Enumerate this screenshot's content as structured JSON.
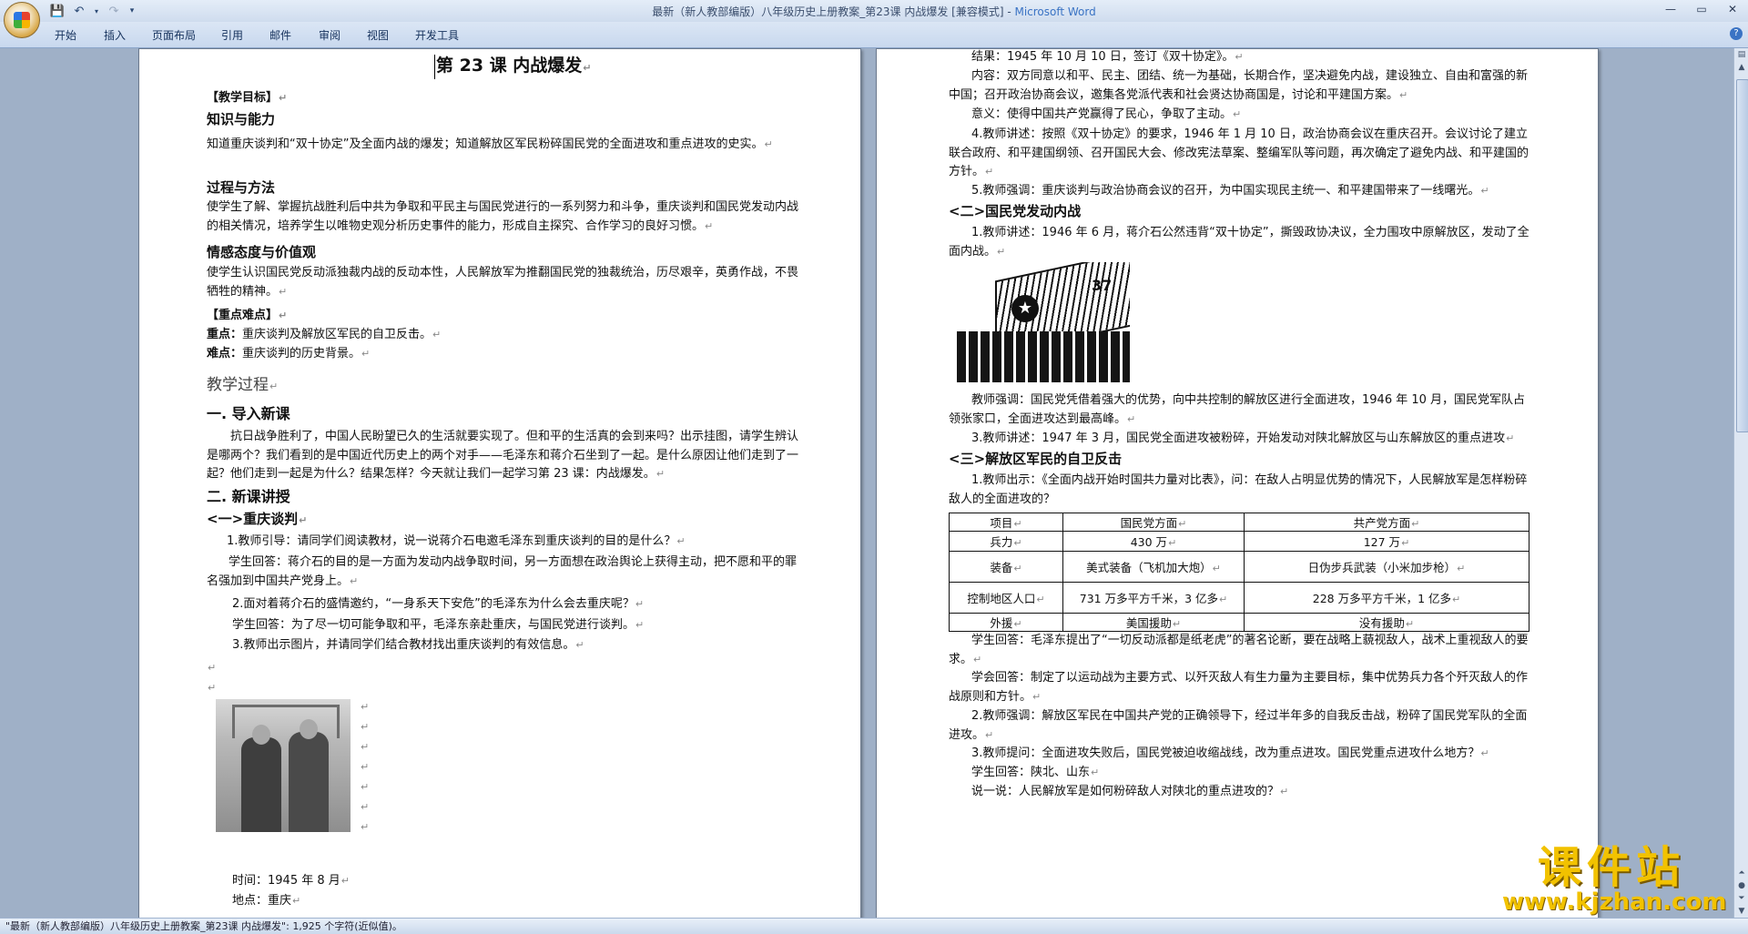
{
  "window": {
    "title_doc": "最新（新人教部编版）八年级历史上册教案_第23课  内战爆发 [兼容模式] - ",
    "title_app": "Microsoft Word"
  },
  "ribbon": {
    "tabs": [
      "开始",
      "插入",
      "页面布局",
      "引用",
      "邮件",
      "审阅",
      "视图",
      "开发工具"
    ]
  },
  "page1": {
    "title": "第 23 课    内战爆发",
    "p1": "【教学目标】",
    "p2": "知识与能力",
    "p3": "知道重庆谈判和“双十协定”及全面内战的爆发；知道解放区军民粉碎国民党的全面进攻和重点进攻的史实。",
    "p4": "过程与方法",
    "p5": "使学生了解、掌握抗战胜利后中共为争取和平民主与国民党进行的一系列努力和斗争，重庆谈判和国民党发动内战的相关情况，培养学生以唯物史观分析历史事件的能力，形成自主探究、合作学习的良好习惯。",
    "p6": "情感态度与价值观",
    "p7": "使学生认识国民党反动派独裁内战的反动本性，人民解放军为推翻国民党的独裁统治，历尽艰辛，英勇作战，不畏牺牲的精神。",
    "p8": "【重点难点】",
    "p9a": "重点：",
    "p9b": "重庆谈判及解放区军民的自卫反击。",
    "p10a": "难点：",
    "p10b": "重庆谈判的历史背景。",
    "p11": "教学过程",
    "p12": "一. 导入新课",
    "p13": "抗日战争胜利了，中国人民盼望已久的生活就要实现了。但和平的生活真的会到来吗？出示挂图，请学生辨认是哪两个？我们看到的是中国近代历史上的两个对手——毛泽东和蒋介石坐到了一起。是什么原因让他们走到了一起？他们走到一起是为什么？结果怎样？今天就让我们一起学习第 23 课：内战爆发。",
    "p14": "二. 新课讲授",
    "p15": "<一>重庆谈判",
    "p16": "1.教师引导：请同学们阅读教材，说一说蒋介石电邀毛泽东到重庆谈判的目的是什么？",
    "p17": "学生回答：蒋介石的目的是一方面为发动内战争取时间，另一方面想在政治舆论上获得主动，把不愿和平的罪名强加到中国共产党身上。",
    "p18": "2.面对着蒋介石的盛情邀约，“一身系天下安危”的毛泽东为什么会去重庆呢？",
    "p19": "学生回答：为了尽一切可能争取和平，毛泽东亲赴重庆，与国民党进行谈判。",
    "p20": "3.教师出示图片，并请同学们结合教材找出重庆谈判的有效信息。",
    "p21": "时间：1945 年 8 月",
    "p22": "地点：重庆"
  },
  "page2": {
    "q1": "结果：1945 年 10 月 10 日，签订《双十协定》。",
    "q2": "内容：双方同意以和平、民主、团结、统一为基础，长期合作，坚决避免内战，建设独立、自由和富强的新中国；召开政治协商会议，邀集各党派代表和社会贤达协商国是，讨论和平建国方案。",
    "q3": "意义：使得中国共产党赢得了民心，争取了主动。",
    "q4": "4.教师讲述：按照《双十协定》的要求，1946 年 1 月 10 日，政治协商会议在重庆召开。会议讨论了建立联合政府、和平建国纲领、召开国民大会、修改宪法草案、整编军队等问题，再次确定了避免内战、和平建国的方针。",
    "q5": "5.教师强调：重庆谈判与政治协商会议的召开，为中国实现民主统一、和平建国带来了一线曙光。",
    "q6": "<二>国民党发动内战",
    "q7": "1.教师讲述：1946 年 6 月，蒋介石公然违背“双十协定”，撕毁政协决议，全力围攻中原解放区，发动了全面内战。",
    "q8": "教师强调：国民党凭借着强大的优势，向中共控制的解放区进行全面进攻，1946 年 10 月，国民党军队占领张家口，全面进攻达到最高峰。",
    "q9": "3.教师讲述：1947 年 3 月，国民党全面进攻被粉碎，开始发动对陕北解放区与山东解放区的重点进攻",
    "q10": "<三>解放区军民的自卫反击",
    "q11": "1.教师出示：《全面内战开始时国共力量对比表》，问：在敌人占明显优势的情况下，人民解放军是怎样粉碎敌人的全面进攻的？",
    "q12": "学生回答：毛泽东提出了“一切反动派都是纸老虎”的著名论断，要在战略上藐视敌人，战术上重视敌人的要求。",
    "q13": "学会回答：制定了以运动战为主要方式、以歼灭敌人有生力量为主要目标，集中优势兵力各个歼灭敌人的作战原则和方针。",
    "q14": "2.教师强调：解放区军民在中国共产党的正确领导下，经过半年多的自我反击战，粉碎了国民党军队的全面进攻。",
    "q15": "3.教师提问：全面进攻失败后，国民党被迫收缩战线，改为重点进攻。国民党重点进攻什么地方？",
    "q16": "学生回答：陕北、山东",
    "q17": "说一说：人民解放军是如何粉碎敌人对陕北的重点进攻的？",
    "plane_number": "37",
    "table": {
      "header": [
        "项目",
        "国民党方面",
        "共产党方面"
      ],
      "rows": [
        [
          "兵力",
          "430 万",
          "127 万"
        ],
        [
          "装备",
          "美式装备（飞机加大炮）",
          "日伪步兵武装（小米加步枪）"
        ],
        [
          "控制地区人口",
          "731 万多平方千米，3 亿多",
          "228 万多平方千米，1 亿多"
        ],
        [
          "外援",
          "美国援助",
          "没有援助"
        ]
      ]
    }
  },
  "status": {
    "text": "\"最新（新人教部编版）八年级历史上册教案_第23课  内战爆发\": 1,925 个字符(近似值)。"
  },
  "watermark": {
    "line1": "课件站",
    "line2": "www.kjzhan.com"
  },
  "colors": {
    "accent": "#3a73c4",
    "workspace": "#9fb0c7",
    "watermark": "#f2c200"
  }
}
